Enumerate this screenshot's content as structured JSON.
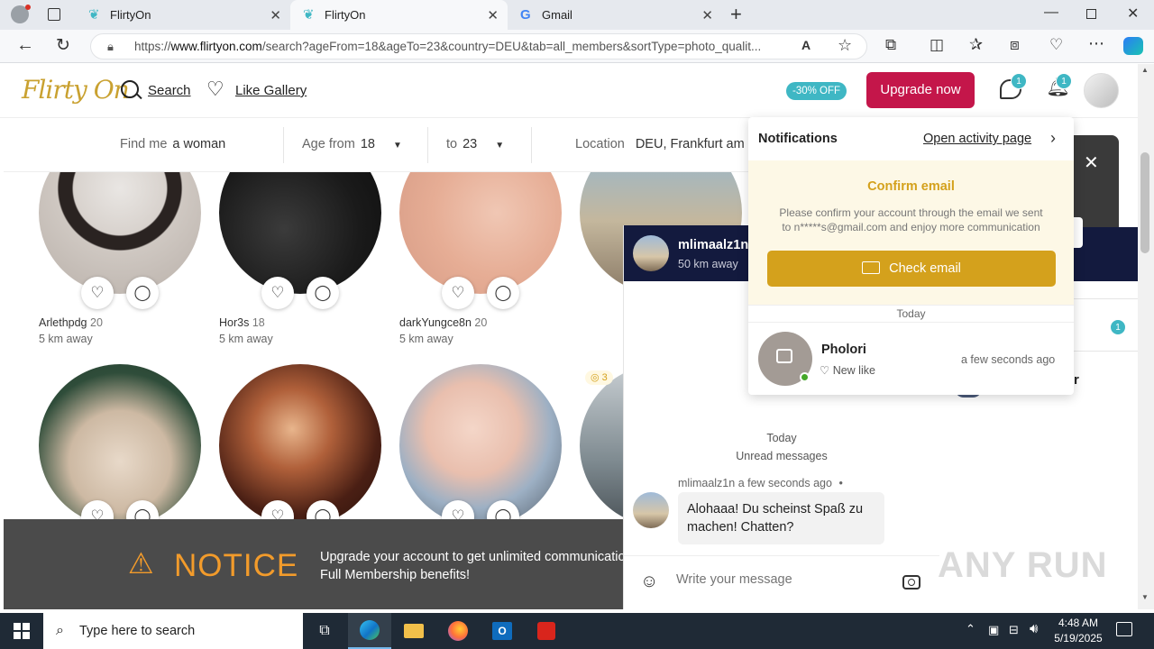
{
  "browser": {
    "tabs": [
      {
        "title": "FlirtyOn",
        "active": false
      },
      {
        "title": "FlirtyOn",
        "active": true
      },
      {
        "title": "Gmail",
        "active": false
      }
    ],
    "url_prefix": "https://",
    "url_domain": "www.flirtyon.com",
    "url_rest": "/search?ageFrom=18&ageTo=23&country=DEU&tab=all_members&sortType=photo_qualit..."
  },
  "header": {
    "logo": "Flirty On",
    "search_label": "Search",
    "gallery_label": "Like Gallery",
    "discount": "-30% OFF",
    "upgrade_label": "Upgrade now",
    "messages_count": "1",
    "notifications_count": "1"
  },
  "filters": {
    "find_label": "Find me",
    "find_value": "a woman",
    "age_from_label": "Age from",
    "age_from_value": "18",
    "age_to_label": "to",
    "age_to_value": "23",
    "location_label": "Location",
    "location_value": "DEU, Frankfurt am Main"
  },
  "members": [
    {
      "name": "Arlethpdg",
      "age": "20",
      "distance": "5 km away"
    },
    {
      "name": "Hor3s",
      "age": "18",
      "distance": "5 km away"
    },
    {
      "name": "darkYungce8n",
      "age": "20",
      "distance": "5 km away"
    },
    {
      "name": "",
      "age": "",
      "distance": ""
    },
    {
      "name": "",
      "age": "",
      "distance": ""
    },
    {
      "name": "",
      "age": "",
      "distance": ""
    },
    {
      "name": "",
      "age": "",
      "distance": ""
    },
    {
      "name": "",
      "age": "",
      "distance": ""
    }
  ],
  "photo_count_badge": "3",
  "notice": {
    "title": "NOTICE",
    "line1": "Upgrade your account to get unlimited communicatio",
    "line2": "Full Membership benefits!"
  },
  "chat": {
    "name": "mlimaalz1n",
    "distance": "50 km away",
    "day": "Today",
    "unread": "Unread messages",
    "msg_sender": "mlimaalz1n",
    "msg_time": "a few seconds ago",
    "msg_text_1": "Alohaaa! Du scheinst Spaß zu",
    "msg_text_2": "machen! Chatten?",
    "compose_placeholder": "Write your message"
  },
  "notifications": {
    "title": "Notifications",
    "link": "Open activity page",
    "confirm_title": "Confirm email",
    "confirm_text_1": "Please confirm your account through the email we sent",
    "confirm_text_2": "to n*****s@gmail.com and enjoy more communication",
    "check_email": "Check email",
    "today": "Today",
    "item_name": "Pholori",
    "item_type": "New like",
    "item_time": "a few seconds ago"
  },
  "right_panel": {
    "badge": "1",
    "partial_text": "r"
  },
  "taskbar": {
    "search_placeholder": "Type here to search",
    "time": "4:48 AM",
    "date": "5/19/2025"
  },
  "watermark": "ANY RUN",
  "colors": {
    "brand_gold": "#c9a130",
    "upgrade_red": "#c4164a",
    "badge_teal": "#3fb7c4",
    "notice_orange": "#f29b2b",
    "chat_header_navy": "#131a3e"
  }
}
